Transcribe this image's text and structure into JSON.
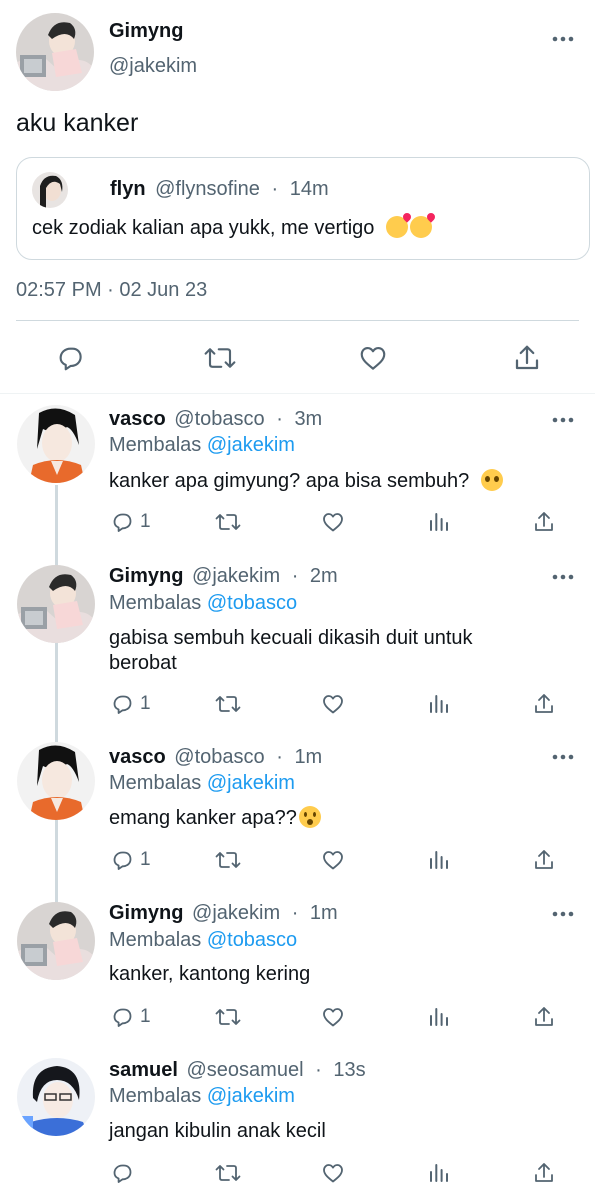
{
  "main_tweet": {
    "display_name": "Gimyng",
    "handle": "@jakekim",
    "text": "aku kanker",
    "quote": {
      "display_name": "flyn",
      "handle": "@flynsofine",
      "time": "14m",
      "text": "cek zodiak kalian apa yukk, me vertigo"
    },
    "timestamp": "02:57 PM · 02 Jun 23"
  },
  "icons": {
    "reply": "reply-icon",
    "retweet": "retweet-icon",
    "like": "heart-icon",
    "share": "share-icon",
    "views": "views-icon",
    "more": "more-icon"
  },
  "replies": [
    {
      "display_name": "vasco",
      "handle": "@tobasco",
      "time": "3m",
      "replying_label": "Membalas",
      "replying_to": "@jakekim",
      "text": "kanker apa gimyung? apa bisa sembuh?",
      "reply_count": "1"
    },
    {
      "display_name": "Gimyng",
      "handle": "@jakekim",
      "time": "2m",
      "replying_label": "Membalas",
      "replying_to": "@tobasco",
      "text": "gabisa sembuh kecuali dikasih duit untuk berobat",
      "reply_count": "1"
    },
    {
      "display_name": "vasco",
      "handle": "@tobasco",
      "time": "1m",
      "replying_label": "Membalas",
      "replying_to": "@jakekim",
      "text": "emang kanker apa??",
      "reply_count": "1"
    },
    {
      "display_name": "Gimyng",
      "handle": "@jakekim",
      "time": "1m",
      "replying_label": "Membalas",
      "replying_to": "@tobasco",
      "text": "kanker, kantong kering",
      "reply_count": "1"
    },
    {
      "display_name": "samuel",
      "handle": "@seosamuel",
      "time": "13s",
      "replying_label": "Membalas",
      "replying_to": "@jakekim",
      "text": "jangan kibulin anak kecil",
      "reply_count": ""
    }
  ],
  "colors": {
    "accent": "#1d9bf0",
    "muted": "#536471",
    "divider": "#cfd9de"
  }
}
